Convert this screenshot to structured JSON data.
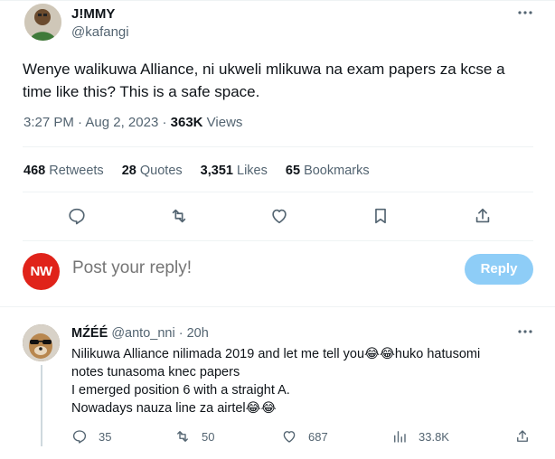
{
  "tweet": {
    "display_name": "J!MMY",
    "handle": "@kafangi",
    "text": "Wenye walikuwa Alliance, ni ukweli mlikuwa na exam papers za kcse a time like this? This is a safe space.",
    "time": "3:27 PM",
    "date": "Aug 2, 2023",
    "views_count": "363K",
    "views_label": "Views",
    "stats": {
      "retweets_count": "468",
      "retweets_label": "Retweets",
      "quotes_count": "28",
      "quotes_label": "Quotes",
      "likes_count": "3,351",
      "likes_label": "Likes",
      "bookmarks_count": "65",
      "bookmarks_label": "Bookmarks"
    },
    "actions": [
      "reply-icon",
      "retweet-icon",
      "like-icon",
      "bookmark-icon",
      "share-icon"
    ]
  },
  "composer": {
    "avatar_initials": "NW",
    "placeholder": "Post your reply!",
    "reply_button_label": "Reply"
  },
  "reply": {
    "display_name": "MŹÉÉ",
    "handle": "@anto_nni",
    "time": "20h",
    "lines": [
      "Nilikuwa Alliance nilimada 2019 and let me tell you😂😂huko hatusomi",
      "notes tunasoma knec papers",
      "I emerged position 6 with a straight A.",
      "Nowadays nauza line za airtel😂😂"
    ],
    "counts": {
      "replies": "35",
      "retweets": "50",
      "likes": "687",
      "views": "33.8K"
    }
  },
  "colors": {
    "text_primary": "#0f1419",
    "text_secondary": "#536471",
    "reply_button": "#8ecdf7",
    "nw_badge": "#e0231a",
    "divider": "#eff3f4"
  }
}
